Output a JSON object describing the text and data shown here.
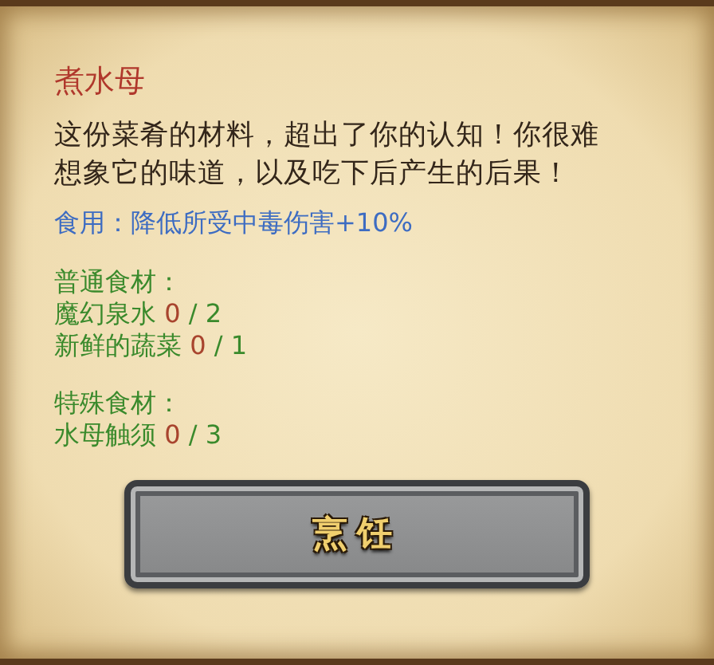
{
  "title": "煮水母",
  "description": "这份菜肴的材料，超出了你的认知！你很难想象它的味道，以及吃下后产生的后果！",
  "effect": "食用：降低所受中毒伤害+10%",
  "sections": [
    {
      "heading": "普通食材：",
      "items": [
        {
          "name": "魔幻泉水",
          "have": "0",
          "need": "/ 2"
        },
        {
          "name": "新鲜的蔬菜",
          "have": "0",
          "need": "/ 1"
        }
      ]
    },
    {
      "heading": "特殊食材：",
      "items": [
        {
          "name": "水母触须",
          "have": "0",
          "need": "/ 3"
        }
      ]
    }
  ],
  "button": "烹饪"
}
